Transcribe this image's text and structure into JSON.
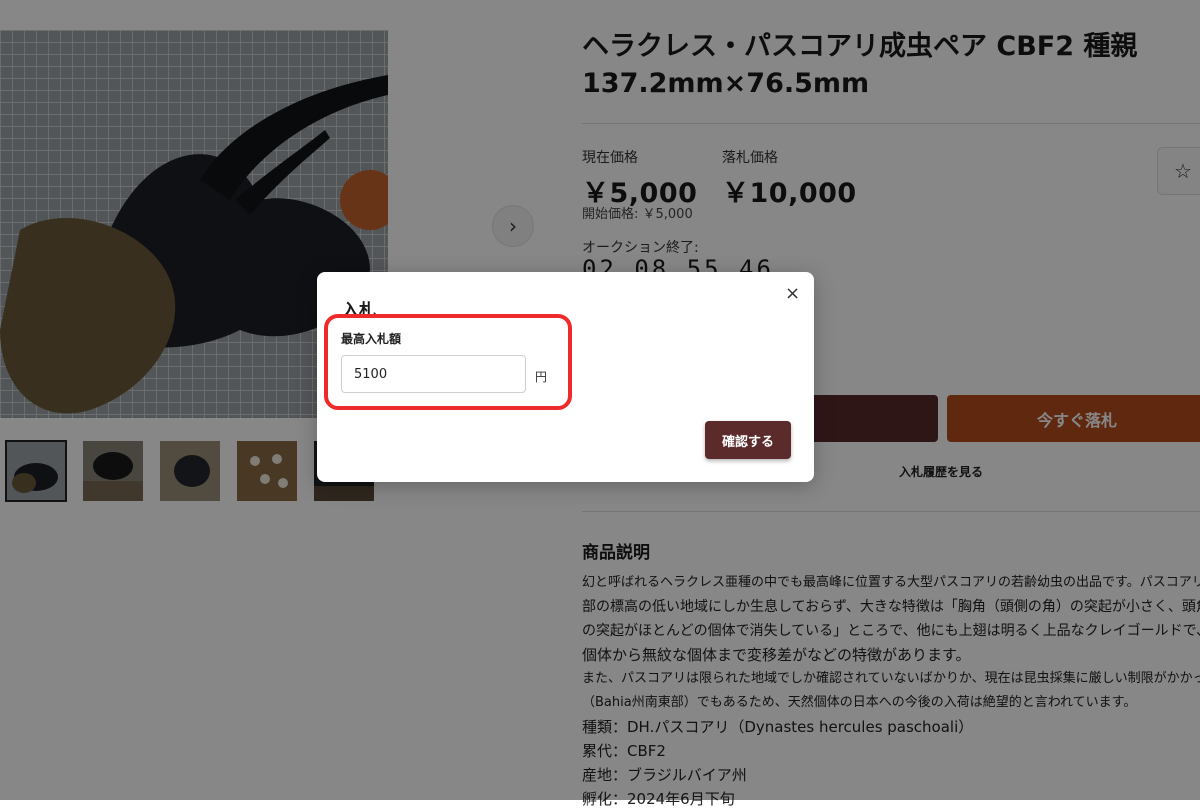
{
  "product": {
    "title_line1": "ヘラクレス・パスコアリ成虫ペア CBF2 種親",
    "title_line2": "137.2mm×76.5mm",
    "current_price_label": "現在価格",
    "current_price": "￥5,000",
    "buyout_price_label": "落札価格",
    "buyout_price": "￥10,000",
    "start_price": "開始価格: ￥5,000",
    "auction_end_label": "オークション終了:",
    "countdown": "02 08 55 46",
    "buy_now_label": "今すぐ落札",
    "bid_history_label": "入札履歴を見る",
    "description_heading": "商品説明",
    "description_lines": [
      "幻と呼ばれるヘラクレス亜種の中でも最高峰に位置する大型パスコアリの若齢幼虫の出品です。パスコアリ",
      "部の標高の低い地域にしか生息しておらず、大きな特徴は「胸角（頭側の角）の突起が小さく、頭角（顔側",
      "の突起がほとんどの個体で消失している」ところで、他にも上翅は明るく上品なクレイゴールドで、",
      "個体から無紋な個体まで変移差がなどの特徴があります。",
      "また、パスコアリは限られた地域でしか確認されていないばかりか、現在は昆虫採集に厳しい制限がかかっ",
      "（Bahia州南東部）でもあるため、天然個体の日本への今後の入荷は絶望的と言われています。"
    ],
    "specs": [
      "種類：DH.パスコアリ（Dynastes hercules paschoali）",
      "累代：CBF2",
      "産地：ブラジルバイア州",
      "孵化：2024年6月下旬"
    ]
  },
  "icons": {
    "next": "›",
    "favorite": "☆",
    "close": "×"
  },
  "modal": {
    "title": "入札",
    "field_label": "最高入札額",
    "bid_value": "5100",
    "unit": "円",
    "confirm_label": "確認する"
  },
  "colors": {
    "bid_button": "#5a2a2a",
    "buy_now_button": "#b34d1e",
    "highlight": "#ef2a2a"
  }
}
